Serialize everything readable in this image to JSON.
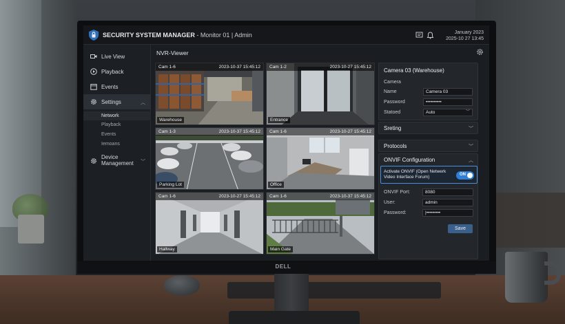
{
  "app": {
    "title": "SECURITY SYSTEM MANAGER",
    "subtitle": " - Monitor 01 | Admin",
    "date_line1": "January 2023",
    "date_line2": "2025-10 27 13:45",
    "brand": "DELL"
  },
  "sidebar": {
    "items": [
      {
        "label": "Live View",
        "icon": "video-camera-icon"
      },
      {
        "label": "Playback",
        "icon": "play-circle-icon"
      },
      {
        "label": "Events",
        "icon": "calendar-icon"
      },
      {
        "label": "Settings",
        "icon": "gear-icon"
      },
      {
        "label": "Device",
        "label2": "Management",
        "icon": "device-gear-icon"
      }
    ],
    "sub_items": [
      "Network",
      "Playback",
      "Events",
      "Iemoans"
    ]
  },
  "main": {
    "title": "NVR-Viewer"
  },
  "cameras": [
    {
      "name": "Cam 1-6",
      "time": "2023-10-37 15:45:12",
      "label": "Warehouse"
    },
    {
      "name": "Cam 1-2",
      "time": "2023-10-27 15:45:12",
      "label": "Entrance"
    },
    {
      "name": "Cam 1-3",
      "time": "2023-10-37 15:45:12",
      "label": "Parking Lot"
    },
    {
      "name": "Cam 1-6",
      "time": "2023-10-27 15:45:12",
      "label": "Office"
    },
    {
      "name": "Cam 1-6",
      "time": "2023-10-27 15:45:12",
      "label": "Hallway"
    },
    {
      "name": "Cam 1-6",
      "time": "2023-10-37 15:45:12",
      "label": "Main Gate"
    }
  ],
  "camera_panel": {
    "title": "Camera 03 (Warehouse)",
    "section": "Camera",
    "fields": [
      {
        "label": "Name",
        "value": "Camera 03"
      },
      {
        "label": "Password",
        "value": "••••••••••"
      },
      {
        "label": "Statoed",
        "value": "Auto"
      }
    ]
  },
  "sections": {
    "streaming": "Sreting",
    "protocols": "Protocols",
    "onvif": "ONVIF Configuration"
  },
  "onvif": {
    "activate_label": "Activate ONVIF (Open Netwerk Video Interface Forum)",
    "toggle_label": "ON",
    "port_label": "ONVIF Port:",
    "port_value": "8080",
    "user_label": "User:",
    "user_value": "admin",
    "password_label": "Password:",
    "password_value": "|•••••••••",
    "save_label": "Save"
  },
  "colors": {
    "accent": "#2f7fd6",
    "panel": "#23272c",
    "screen": "#1a1d21"
  }
}
